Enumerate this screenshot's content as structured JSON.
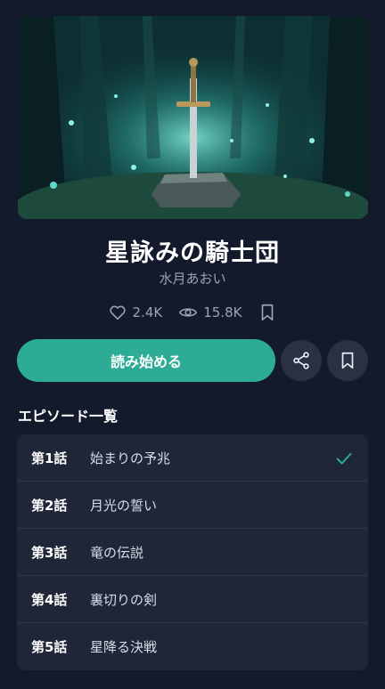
{
  "book": {
    "title": "星詠みの騎士団",
    "author": "水月あおい"
  },
  "stats": {
    "likes": "2.4K",
    "views": "15.8K"
  },
  "actions": {
    "read_label": "読み始める"
  },
  "episodes": {
    "heading": "エピソード一覧",
    "items": [
      {
        "number": "第1話",
        "title": "始まりの予兆",
        "read": true
      },
      {
        "number": "第2話",
        "title": "月光の誓い",
        "read": false
      },
      {
        "number": "第3話",
        "title": "竜の伝説",
        "read": false
      },
      {
        "number": "第4話",
        "title": "裏切りの剣",
        "read": false
      },
      {
        "number": "第5話",
        "title": "星降る決戦",
        "read": false
      }
    ]
  },
  "colors": {
    "background": "#131a2b",
    "accent": "#2dac95",
    "card": "#1f2638",
    "muted_text": "#9aa3b5"
  },
  "icons": [
    "heart-icon",
    "eye-icon",
    "bookmark-icon",
    "share-icon",
    "check-icon"
  ]
}
